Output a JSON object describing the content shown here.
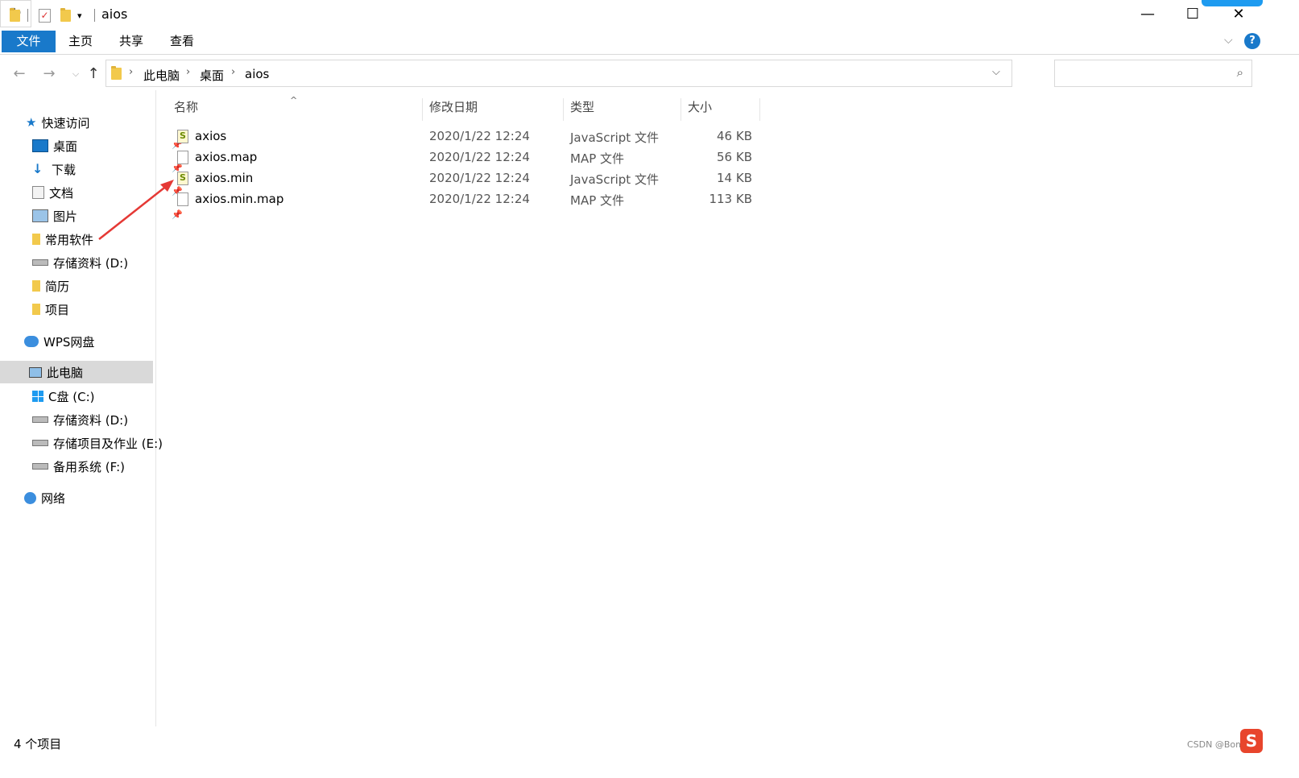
{
  "window": {
    "title": "aios",
    "minimize": "—",
    "maximize": "☐",
    "close": "✕"
  },
  "ribbon": {
    "tabs": [
      "文件",
      "主页",
      "共享",
      "查看"
    ]
  },
  "address": {
    "crumbs": [
      "此电脑",
      "桌面",
      "aios"
    ]
  },
  "nav": {
    "quick_access": "快速访问",
    "quick_items": [
      {
        "label": "桌面",
        "icon": "desktop-icon",
        "pinned": true
      },
      {
        "label": "下载",
        "icon": "download-icon",
        "pinned": true
      },
      {
        "label": "文档",
        "icon": "document-icon",
        "pinned": true
      },
      {
        "label": "图片",
        "icon": "picture-icon",
        "pinned": true
      },
      {
        "label": "常用软件",
        "icon": "folder-icon",
        "pinned": false
      },
      {
        "label": "存储资料 (D:)",
        "icon": "drive-icon",
        "pinned": false
      },
      {
        "label": "简历",
        "icon": "folder-icon",
        "pinned": false
      },
      {
        "label": "项目",
        "icon": "folder-icon",
        "pinned": false
      }
    ],
    "wps": "WPS网盘",
    "this_pc": "此电脑",
    "drives": [
      "C盘 (C:)",
      "存储资料 (D:)",
      "存储项目及作业 (E:)",
      "备用系统 (F:)"
    ],
    "network": "网络"
  },
  "columns": {
    "name": "名称",
    "date": "修改日期",
    "type": "类型",
    "size": "大小"
  },
  "files": [
    {
      "name": "axios",
      "date": "2020/1/22 12:24",
      "type": "JavaScript 文件",
      "size": "46 KB",
      "icon": "js-file-icon"
    },
    {
      "name": "axios.map",
      "date": "2020/1/22 12:24",
      "type": "MAP 文件",
      "size": "56 KB",
      "icon": "file-icon"
    },
    {
      "name": "axios.min",
      "date": "2020/1/22 12:24",
      "type": "JavaScript 文件",
      "size": "14 KB",
      "icon": "js-file-icon"
    },
    {
      "name": "axios.min.map",
      "date": "2020/1/22 12:24",
      "type": "MAP 文件",
      "size": "113 KB",
      "icon": "file-icon"
    }
  ],
  "status": {
    "count": "4 个项目"
  },
  "watermark": "CSDN @Bomber",
  "colors": {
    "accent": "#1979ca",
    "selection": "#d9d9d9",
    "annotation_arrow": "#e53935"
  }
}
